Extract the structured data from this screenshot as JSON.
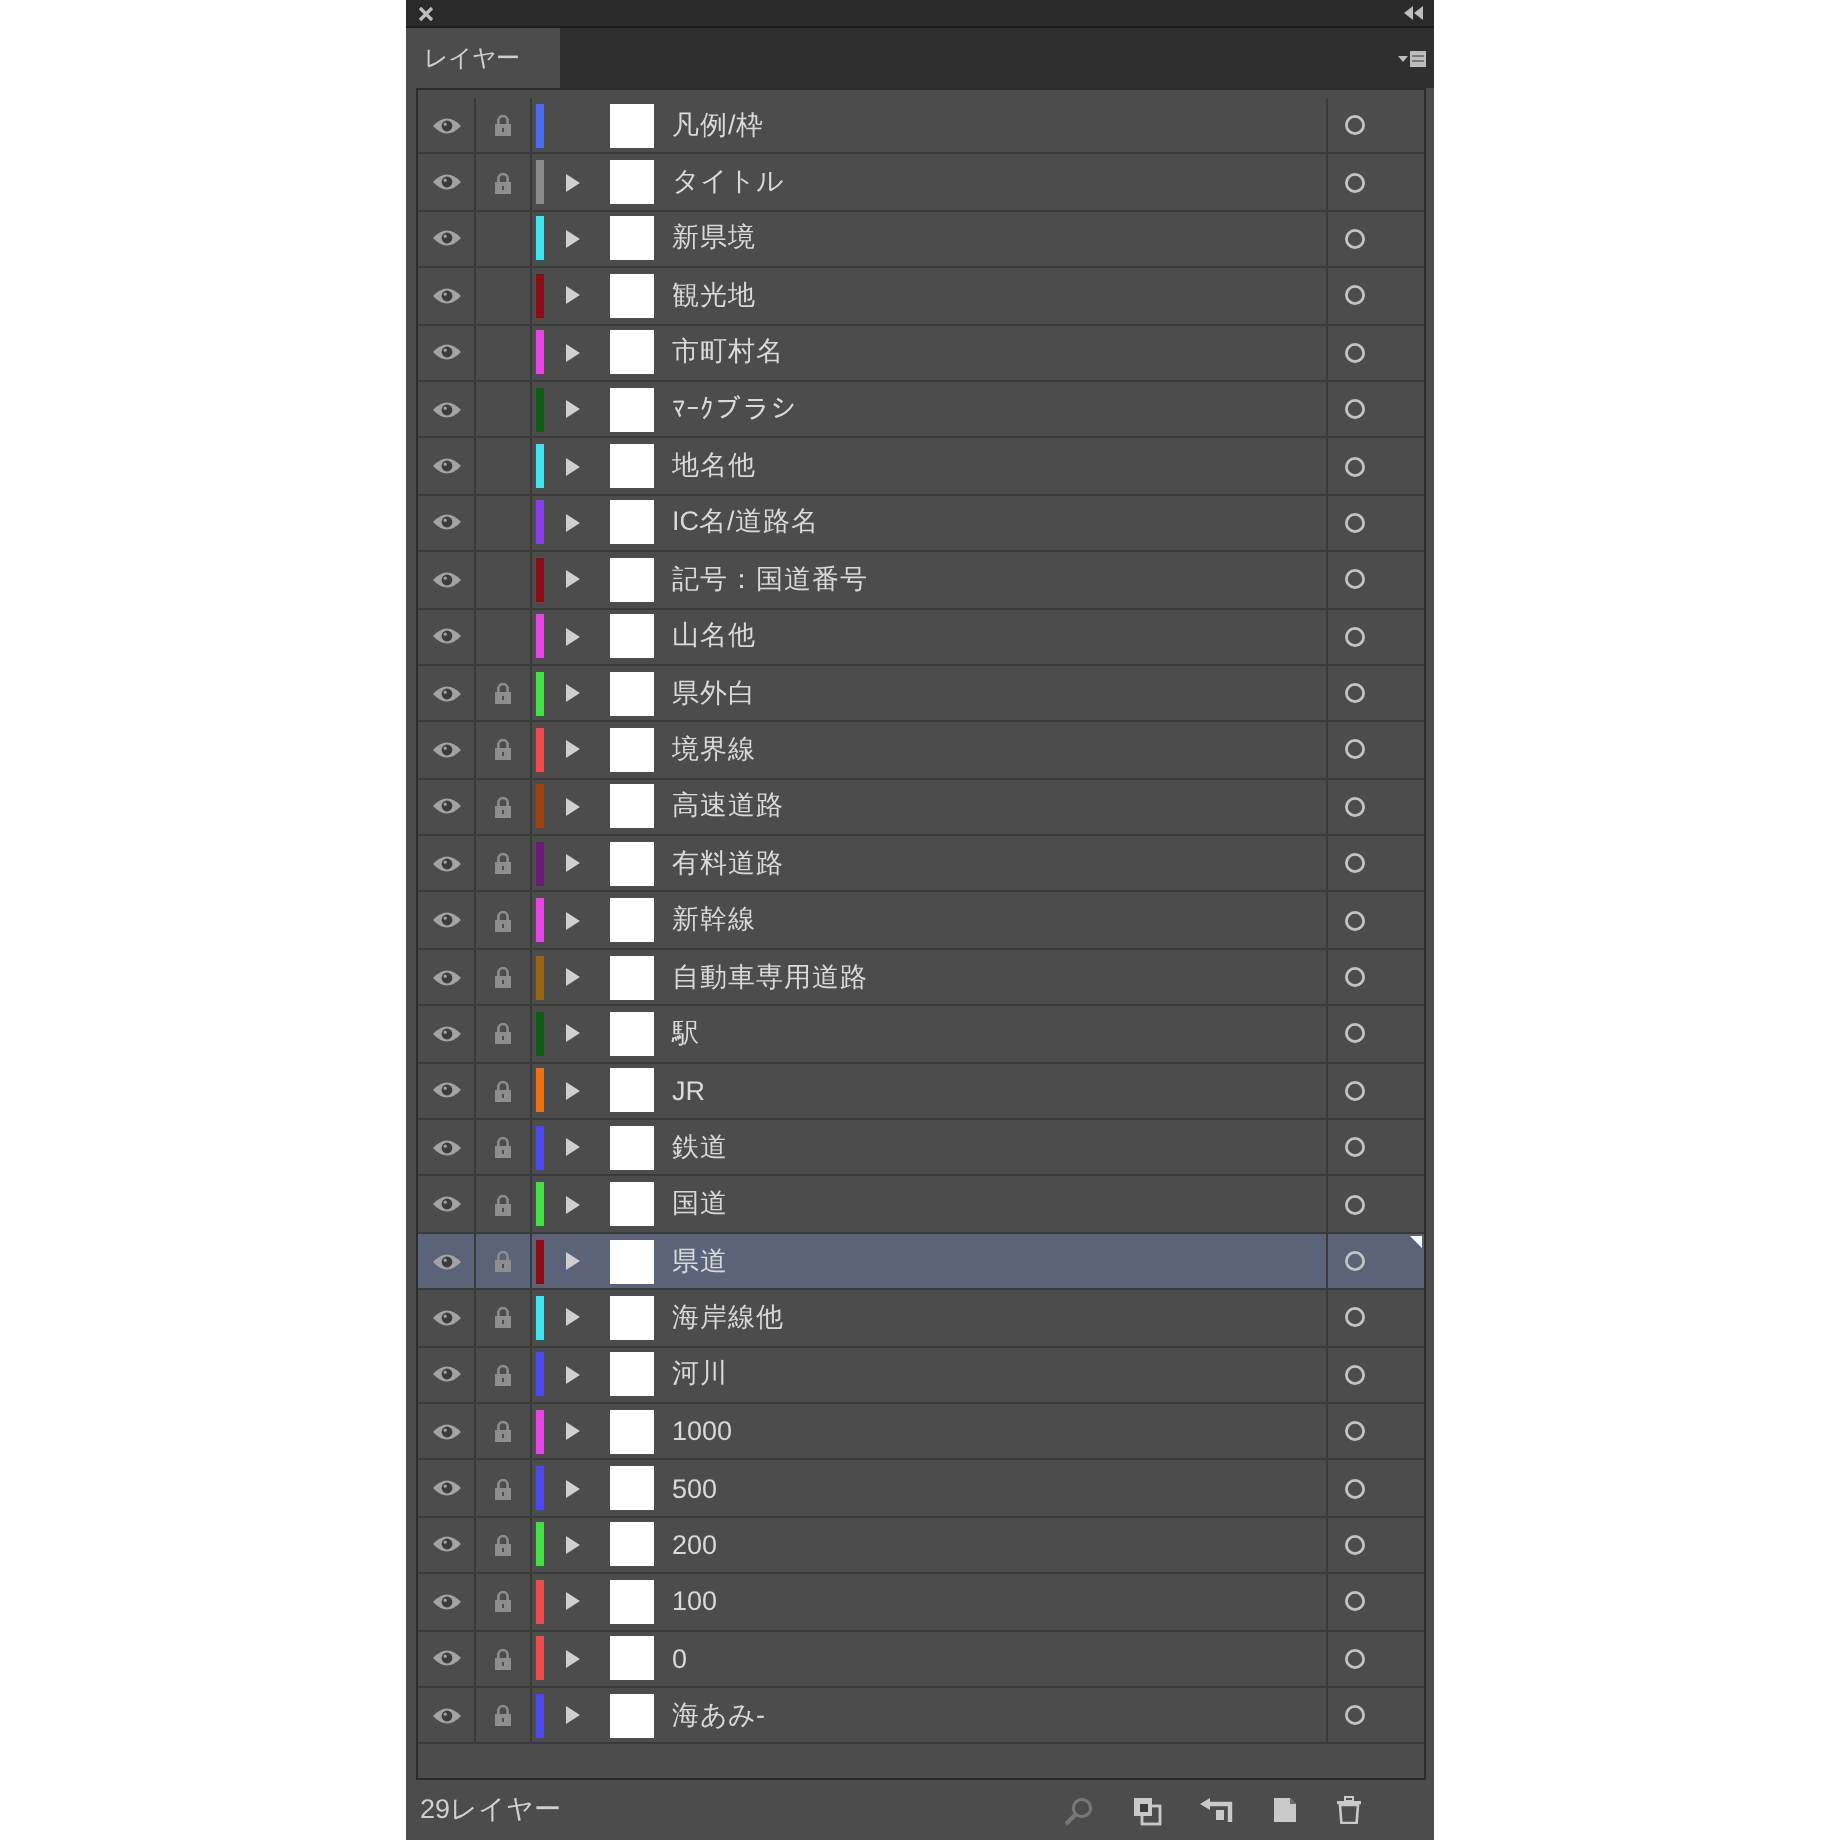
{
  "window": {
    "tab": {
      "label": "レイヤー",
      "selected": true
    }
  },
  "layers": [
    {
      "name": "凡例/枠",
      "visible": true,
      "locked": true,
      "color": "#4a6cf0",
      "kind": "leaf",
      "selected": false
    },
    {
      "name": "タイトル",
      "visible": true,
      "locked": true,
      "color": "#8a8a8a",
      "kind": "parent",
      "expanded": false,
      "selected": false
    },
    {
      "name": "新県境",
      "visible": true,
      "locked": false,
      "color": "#40e4f0",
      "kind": "parent",
      "expanded": false,
      "selected": false
    },
    {
      "name": "観光地",
      "visible": true,
      "locked": false,
      "color": "#8c0a14",
      "kind": "parent",
      "expanded": false,
      "selected": false
    },
    {
      "name": "市町村名",
      "visible": true,
      "locked": false,
      "color": "#e844e8",
      "kind": "parent",
      "expanded": false,
      "selected": false
    },
    {
      "name": "ﾏｰｸブラシ",
      "visible": true,
      "locked": false,
      "color": "#0f5a14",
      "kind": "parent",
      "expanded": false,
      "selected": false
    },
    {
      "name": "地名他",
      "visible": true,
      "locked": false,
      "color": "#40e4f0",
      "kind": "parent",
      "expanded": false,
      "selected": false
    },
    {
      "name": "IC名/道路名",
      "visible": true,
      "locked": false,
      "color": "#8a3cf0",
      "kind": "parent",
      "expanded": false,
      "selected": false
    },
    {
      "name": "記号：国道番号",
      "visible": true,
      "locked": false,
      "color": "#8c0a14",
      "kind": "parent",
      "expanded": false,
      "selected": false
    },
    {
      "name": "山名他",
      "visible": true,
      "locked": false,
      "color": "#e844e8",
      "kind": "parent",
      "expanded": false,
      "selected": false
    },
    {
      "name": "県外白",
      "visible": true,
      "locked": true,
      "color": "#44e044",
      "kind": "parent",
      "expanded": false,
      "selected": false
    },
    {
      "name": "境界線",
      "visible": true,
      "locked": true,
      "color": "#f04a4a",
      "kind": "parent",
      "expanded": false,
      "selected": false
    },
    {
      "name": "高速道路",
      "visible": true,
      "locked": true,
      "color": "#a0400e",
      "kind": "parent",
      "expanded": false,
      "selected": false
    },
    {
      "name": "有料道路",
      "visible": true,
      "locked": true,
      "color": "#6c1a78",
      "kind": "parent",
      "expanded": false,
      "selected": false
    },
    {
      "name": "新幹線",
      "visible": true,
      "locked": true,
      "color": "#e844e8",
      "kind": "parent",
      "expanded": false,
      "selected": false
    },
    {
      "name": "自動車専用道路",
      "visible": true,
      "locked": true,
      "color": "#9a6410",
      "kind": "parent",
      "expanded": false,
      "selected": false
    },
    {
      "name": "駅",
      "visible": true,
      "locked": true,
      "color": "#0f5a14",
      "kind": "parent",
      "expanded": false,
      "selected": false
    },
    {
      "name": "JR",
      "visible": true,
      "locked": true,
      "color": "#f07010",
      "kind": "parent",
      "expanded": false,
      "selected": false
    },
    {
      "name": "鉄道",
      "visible": true,
      "locked": true,
      "color": "#4a4af0",
      "kind": "parent",
      "expanded": false,
      "selected": false
    },
    {
      "name": "国道",
      "visible": true,
      "locked": true,
      "color": "#44e044",
      "kind": "parent",
      "expanded": false,
      "selected": false
    },
    {
      "name": "県道",
      "visible": true,
      "locked": true,
      "color": "#8c0a14",
      "kind": "parent",
      "expanded": false,
      "selected": true
    },
    {
      "name": "海岸線他",
      "visible": true,
      "locked": true,
      "color": "#40e4f0",
      "kind": "parent",
      "expanded": false,
      "selected": false
    },
    {
      "name": "河川",
      "visible": true,
      "locked": true,
      "color": "#4a4af0",
      "kind": "parent",
      "expanded": false,
      "selected": false
    },
    {
      "name": "1000",
      "visible": true,
      "locked": true,
      "color": "#e844e8",
      "kind": "parent",
      "expanded": false,
      "selected": false
    },
    {
      "name": "500",
      "visible": true,
      "locked": true,
      "color": "#4a4af0",
      "kind": "parent",
      "expanded": false,
      "selected": false
    },
    {
      "name": "200",
      "visible": true,
      "locked": true,
      "color": "#44e044",
      "kind": "parent",
      "expanded": false,
      "selected": false
    },
    {
      "name": "100",
      "visible": true,
      "locked": true,
      "color": "#f04a4a",
      "kind": "parent",
      "expanded": false,
      "selected": false
    },
    {
      "name": "0",
      "visible": true,
      "locked": true,
      "color": "#f04a4a",
      "kind": "parent",
      "expanded": false,
      "selected": false
    },
    {
      "name": "海あみ-",
      "visible": true,
      "locked": true,
      "color": "#4a4af0",
      "kind": "parent",
      "expanded": false,
      "selected": false
    }
  ],
  "footer": {
    "count": "29レイヤー",
    "tools": [
      {
        "kind": "locate",
        "disabled": true
      },
      {
        "kind": "clip",
        "disabled": false
      },
      {
        "kind": "sublayer",
        "disabled": false
      },
      {
        "kind": "new",
        "disabled": false
      },
      {
        "kind": "delete",
        "disabled": false
      }
    ]
  }
}
